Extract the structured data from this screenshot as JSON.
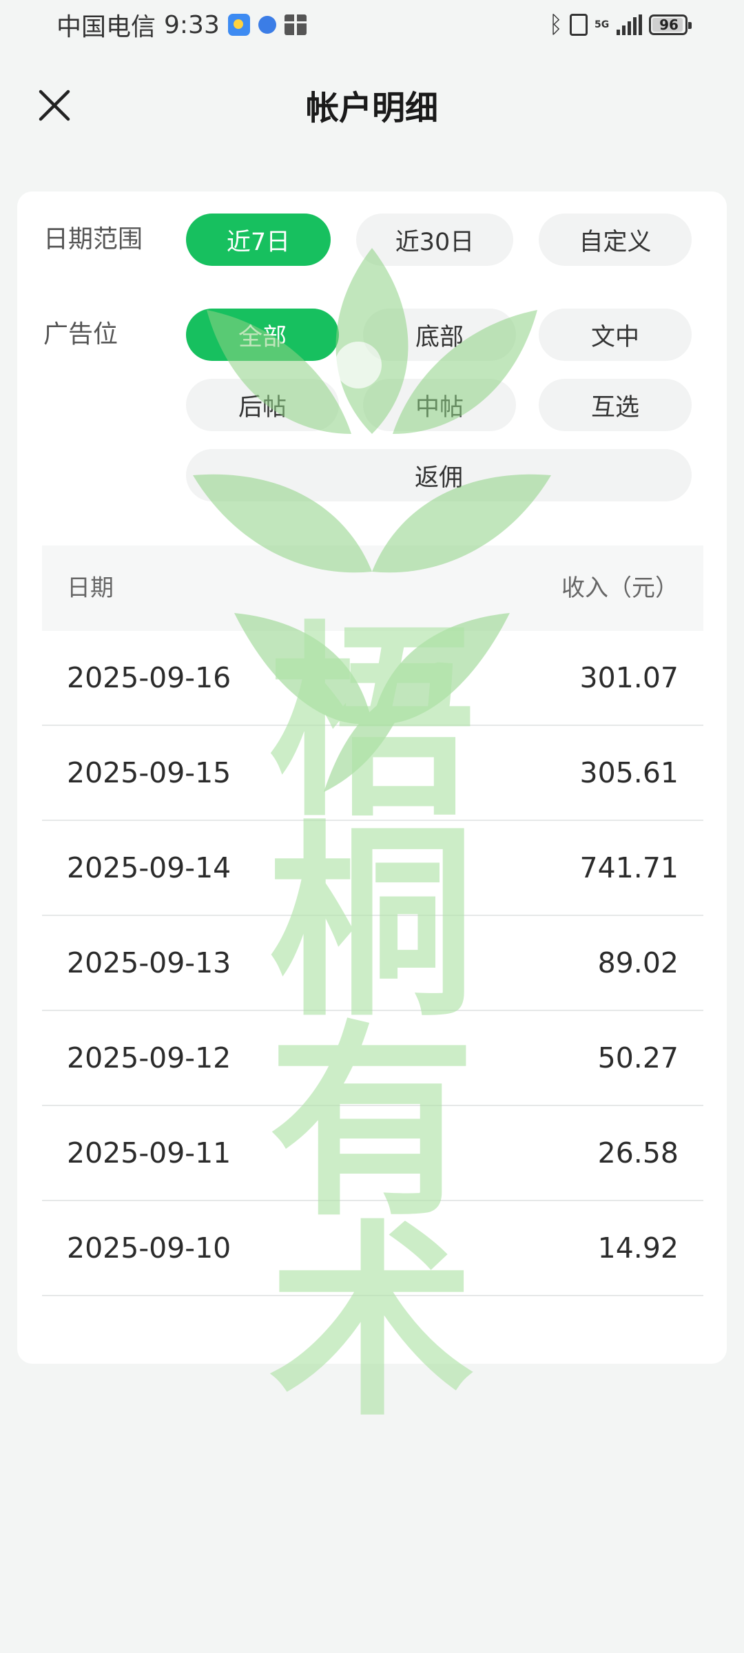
{
  "status_bar": {
    "carrier": "中国电信",
    "time": "9:33",
    "network": "5G",
    "battery": "96",
    "icons": [
      "weather-app-icon",
      "globe-app-icon",
      "gift-app-icon",
      "bluetooth-icon",
      "vibrate-icon",
      "signal-icon",
      "battery-icon"
    ]
  },
  "header": {
    "title": "帐户明细",
    "close_icon": "close-icon"
  },
  "filters": {
    "date_range": {
      "label": "日期范围",
      "options": [
        "近7日",
        "近30日",
        "自定义"
      ],
      "selected": "近7日"
    },
    "ad_slot": {
      "label": "广告位",
      "options": [
        "全部",
        "底部",
        "文中",
        "后帖",
        "中帖",
        "互选",
        "返佣"
      ],
      "selected": "全部"
    }
  },
  "table": {
    "headers": {
      "date": "日期",
      "income": "收入（元）"
    },
    "rows": [
      {
        "date": "2025-09-16",
        "income": "301.07"
      },
      {
        "date": "2025-09-15",
        "income": "305.61"
      },
      {
        "date": "2025-09-14",
        "income": "741.71"
      },
      {
        "date": "2025-09-13",
        "income": "89.02"
      },
      {
        "date": "2025-09-12",
        "income": "50.27"
      },
      {
        "date": "2025-09-11",
        "income": "26.58"
      },
      {
        "date": "2025-09-10",
        "income": "14.92"
      }
    ]
  },
  "watermark": {
    "characters": [
      "梧",
      "桐",
      "有",
      "术"
    ],
    "color": "#aee3a6"
  },
  "colors": {
    "accent": "#17c05f",
    "background": "#f3f5f4",
    "card": "#ffffff"
  }
}
